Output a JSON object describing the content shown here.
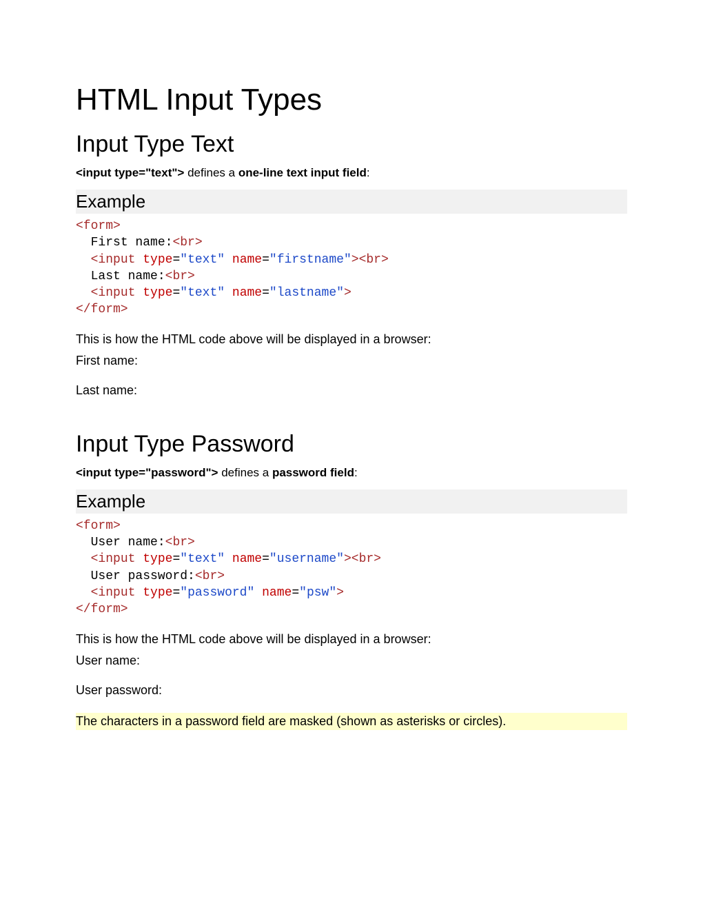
{
  "page_title": "HTML Input Types",
  "sections": [
    {
      "heading": "Input Type Text",
      "def_code": "<input type=\"text\">",
      "def_mid": " defines a ",
      "def_bold": "one-line text input field",
      "def_post": ":",
      "example_label": "Example",
      "code_tokens": [
        {
          "t": "tag",
          "v": "<form>"
        },
        {
          "t": "nl"
        },
        {
          "t": "indent"
        },
        {
          "t": "text",
          "v": "First name:"
        },
        {
          "t": "tag",
          "v": "<br>"
        },
        {
          "t": "nl"
        },
        {
          "t": "indent"
        },
        {
          "t": "tag",
          "v": "<input"
        },
        {
          "t": "text",
          "v": " "
        },
        {
          "t": "attr",
          "v": "type"
        },
        {
          "t": "text",
          "v": "="
        },
        {
          "t": "val",
          "v": "\"text\""
        },
        {
          "t": "text",
          "v": " "
        },
        {
          "t": "attr",
          "v": "name"
        },
        {
          "t": "text",
          "v": "="
        },
        {
          "t": "val",
          "v": "\"firstname\""
        },
        {
          "t": "tag",
          "v": ">"
        },
        {
          "t": "tag",
          "v": "<br>"
        },
        {
          "t": "nl"
        },
        {
          "t": "indent"
        },
        {
          "t": "text",
          "v": "Last name:"
        },
        {
          "t": "tag",
          "v": "<br>"
        },
        {
          "t": "nl"
        },
        {
          "t": "indent"
        },
        {
          "t": "tag",
          "v": "<input"
        },
        {
          "t": "text",
          "v": " "
        },
        {
          "t": "attr",
          "v": "type"
        },
        {
          "t": "text",
          "v": "="
        },
        {
          "t": "val",
          "v": "\"text\""
        },
        {
          "t": "text",
          "v": " "
        },
        {
          "t": "attr",
          "v": "name"
        },
        {
          "t": "text",
          "v": "="
        },
        {
          "t": "val",
          "v": "\"lastname\""
        },
        {
          "t": "tag",
          "v": ">"
        },
        {
          "t": "nl"
        },
        {
          "t": "tag",
          "v": "</form>"
        }
      ],
      "render_intro": "This is how the HTML code above will be displayed in a browser:",
      "demo_fields": [
        "First name:",
        "Last name:"
      ],
      "note": null
    },
    {
      "heading": "Input Type Password",
      "def_code": "<input type=\"password\">",
      "def_mid": " defines a ",
      "def_bold": "password field",
      "def_post": ":",
      "example_label": "Example",
      "code_tokens": [
        {
          "t": "tag",
          "v": "<form>"
        },
        {
          "t": "nl"
        },
        {
          "t": "indent"
        },
        {
          "t": "text",
          "v": "User name:"
        },
        {
          "t": "tag",
          "v": "<br>"
        },
        {
          "t": "nl"
        },
        {
          "t": "indent"
        },
        {
          "t": "tag",
          "v": "<input"
        },
        {
          "t": "text",
          "v": " "
        },
        {
          "t": "attr",
          "v": "type"
        },
        {
          "t": "text",
          "v": "="
        },
        {
          "t": "val",
          "v": "\"text\""
        },
        {
          "t": "text",
          "v": " "
        },
        {
          "t": "attr",
          "v": "name"
        },
        {
          "t": "text",
          "v": "="
        },
        {
          "t": "val",
          "v": "\"username\""
        },
        {
          "t": "tag",
          "v": ">"
        },
        {
          "t": "tag",
          "v": "<br>"
        },
        {
          "t": "nl"
        },
        {
          "t": "indent"
        },
        {
          "t": "text",
          "v": "User password:"
        },
        {
          "t": "tag",
          "v": "<br>"
        },
        {
          "t": "nl"
        },
        {
          "t": "indent"
        },
        {
          "t": "tag",
          "v": "<input"
        },
        {
          "t": "text",
          "v": " "
        },
        {
          "t": "attr",
          "v": "type"
        },
        {
          "t": "text",
          "v": "="
        },
        {
          "t": "val",
          "v": "\"password\""
        },
        {
          "t": "text",
          "v": " "
        },
        {
          "t": "attr",
          "v": "name"
        },
        {
          "t": "text",
          "v": "="
        },
        {
          "t": "val",
          "v": "\"psw\""
        },
        {
          "t": "tag",
          "v": ">"
        },
        {
          "t": "nl"
        },
        {
          "t": "tag",
          "v": "</form>"
        }
      ],
      "render_intro": "This is how the HTML code above will be displayed in a browser:",
      "demo_fields": [
        "User name:",
        "User password:"
      ],
      "note": "The characters in a password field are masked (shown as asterisks or circles)."
    }
  ]
}
